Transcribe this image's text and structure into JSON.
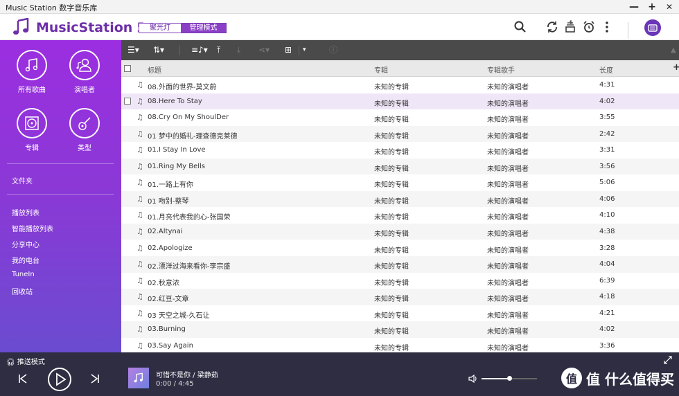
{
  "window": {
    "title": "Music Station 数字音乐库",
    "minimize": "—",
    "maximize": "+",
    "close": "✕"
  },
  "header": {
    "app_name_bold": "MusicStation",
    "app_name_rest": " 5",
    "mode_spotlight": "聚光灯",
    "mode_manage": "管理模式"
  },
  "sidebar": {
    "categories": [
      {
        "label": "所有歌曲",
        "icon": "music-note-icon"
      },
      {
        "label": "演唱者",
        "icon": "singer-icon"
      },
      {
        "label": "专辑",
        "icon": "album-icon"
      },
      {
        "label": "类型",
        "icon": "guitar-icon"
      }
    ],
    "folders": "文件夹",
    "items": [
      "播放列表",
      "智能播放列表",
      "分享中心",
      "我的电台",
      "TuneIn",
      "回收站"
    ]
  },
  "table": {
    "columns": {
      "title": "标题",
      "album": "专辑",
      "artist": "专辑歌手",
      "length": "长度"
    },
    "add": "+",
    "rows": [
      {
        "title": "08.外面的世界-莫文蔚",
        "album": "未知的专辑",
        "artist": "未知的演唱者",
        "length": "4:31"
      },
      {
        "title": "08.Here To Stay",
        "album": "未知的专辑",
        "artist": "未知的演唱者",
        "length": "4:02"
      },
      {
        "title": "08.Cry On My ShoulDer",
        "album": "未知的专辑",
        "artist": "未知的演唱者",
        "length": "3:55"
      },
      {
        "title": "01 梦中的婚礼-理查德克莱德",
        "album": "未知的专辑",
        "artist": "未知的演唱者",
        "length": "2:42"
      },
      {
        "title": "01.I Stay In Love",
        "album": "未知的专辑",
        "artist": "未知的演唱者",
        "length": "3:31"
      },
      {
        "title": "01.Ring My Bells",
        "album": "未知的专辑",
        "artist": "未知的演唱者",
        "length": "3:56"
      },
      {
        "title": "01.一路上有你",
        "album": "未知的专辑",
        "artist": "未知的演唱者",
        "length": "5:06"
      },
      {
        "title": "01 吻别-蔡琴",
        "album": "未知的专辑",
        "artist": "未知的演唱者",
        "length": "4:06"
      },
      {
        "title": "01.月亮代表我的心-张国荣",
        "album": "未知的专辑",
        "artist": "未知的演唱者",
        "length": "4:10"
      },
      {
        "title": "02.Altynai",
        "album": "未知的专辑",
        "artist": "未知的演唱者",
        "length": "4:38"
      },
      {
        "title": "02.Apologize",
        "album": "未知的专辑",
        "artist": "未知的演唱者",
        "length": "3:28"
      },
      {
        "title": "02.漂洋过海来看你-李宗盛",
        "album": "未知的专辑",
        "artist": "未知的演唱者",
        "length": "4:04"
      },
      {
        "title": "02.秋意浓",
        "album": "未知的专辑",
        "artist": "未知的演唱者",
        "length": "6:39"
      },
      {
        "title": "02.红豆-文章",
        "album": "未知的专辑",
        "artist": "未知的演唱者",
        "length": "4:18"
      },
      {
        "title": "03 天空之城-久石让",
        "album": "未知的专辑",
        "artist": "未知的演唱者",
        "length": "4:21"
      },
      {
        "title": "03.Burning",
        "album": "未知的专辑",
        "artist": "未知的演唱者",
        "length": "4:02"
      },
      {
        "title": "03.Say Again",
        "album": "未知的专辑",
        "artist": "未知的演唱者",
        "length": "3:36"
      }
    ],
    "selected_row": 1
  },
  "player": {
    "push_mode": "推送模式",
    "song": "可惜不是你 / 梁静茹",
    "time": "0:00 / 4:45",
    "volume_fraction": 0.5
  },
  "watermark": {
    "text": "值 什么值得买",
    "mark": "值"
  },
  "colors": {
    "accent": "#8a3fc6",
    "sidebar_top": "#9b2ee0",
    "toolbar": "#4a4a4a",
    "player": "#2e2d42"
  }
}
